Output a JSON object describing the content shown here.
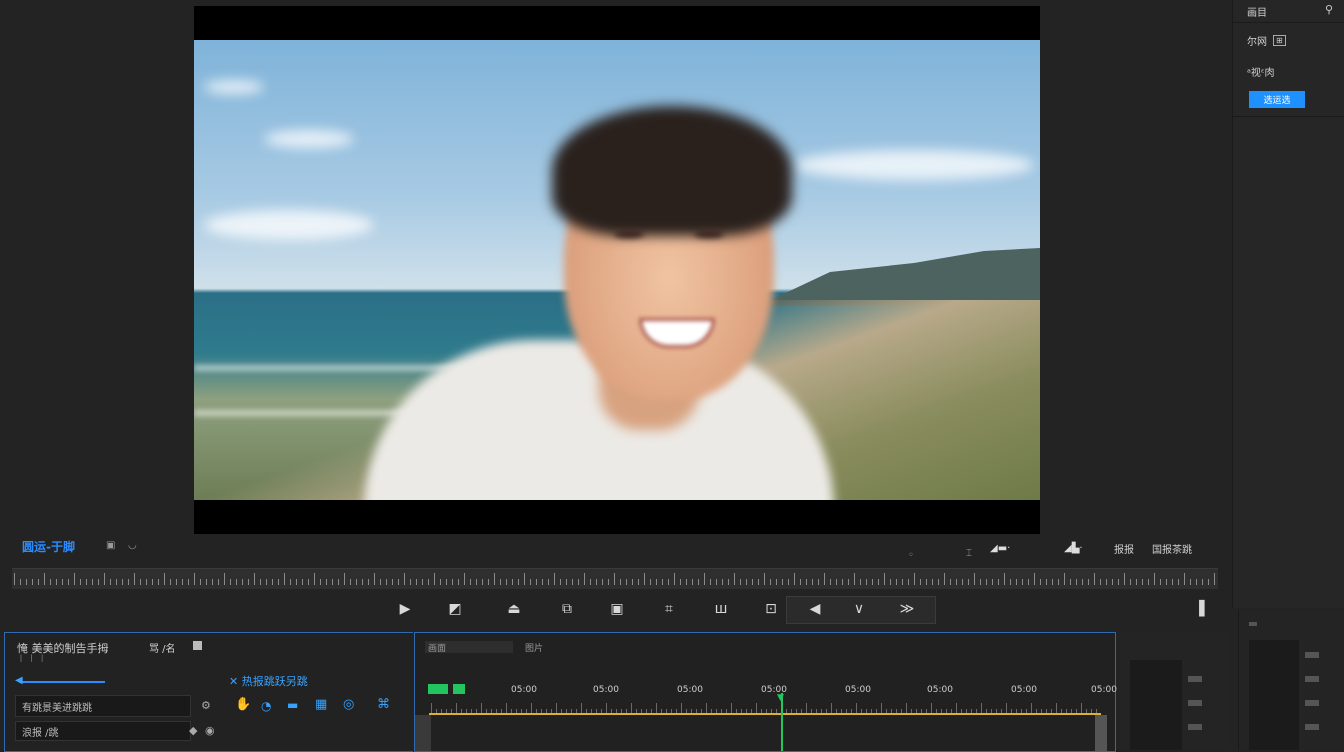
{
  "colors": {
    "accent": "#1e90ff",
    "timecode": "#2b8cff",
    "playhead": "#22c55e",
    "track_line": "#e0b030"
  },
  "preview": {
    "alt": "video preview frame: smiling person at beach"
  },
  "right_panel": {
    "row1": "画目",
    "row2": "尔网",
    "row3": "ᵃ视ᵋ肉",
    "button": "选运选"
  },
  "monitor": {
    "timecode": "圆运-于脚",
    "right_labels": [
      "报报",
      "国报茶跳"
    ]
  },
  "controls": [
    {
      "name": "step-back-icon",
      "glyph": "▶"
    },
    {
      "name": "mark-in-icon",
      "glyph": "◩"
    },
    {
      "name": "lift-icon",
      "glyph": "⏏"
    },
    {
      "name": "insert-icon",
      "glyph": "⧉"
    },
    {
      "name": "overwrite-icon",
      "glyph": "▣"
    },
    {
      "name": "export-frame-icon",
      "glyph": "⌗"
    },
    {
      "name": "trim-icon",
      "glyph": "ш"
    },
    {
      "name": "compare-icon",
      "glyph": "⊡"
    },
    {
      "name": "shuttle-left-icon",
      "glyph": "◀"
    },
    {
      "name": "shuttle-mid-icon",
      "glyph": "∨"
    },
    {
      "name": "shuttle-right-icon",
      "glyph": "≫"
    },
    {
      "name": "fit-icon",
      "glyph": "▐"
    }
  ],
  "left_panel": {
    "title": "㤿 美美的制告手拇",
    "title_sub": "⼁ ⼁ ⼁",
    "tab": "骂 /名",
    "subheading": "✕ 热报跳跃另跳",
    "field1": "有跳景美进跳跳",
    "field2": "浪报 /跳",
    "tools": [
      "✋",
      "◔",
      "▬",
      "▦",
      "◎",
      "⌘"
    ]
  },
  "timeline": {
    "tab1": "画面",
    "tab2": "图片",
    "markers": [
      "05:00",
      "05:00",
      "05:00",
      "05:00",
      "05:00",
      "05:00",
      "05:00",
      "05:00"
    ]
  }
}
